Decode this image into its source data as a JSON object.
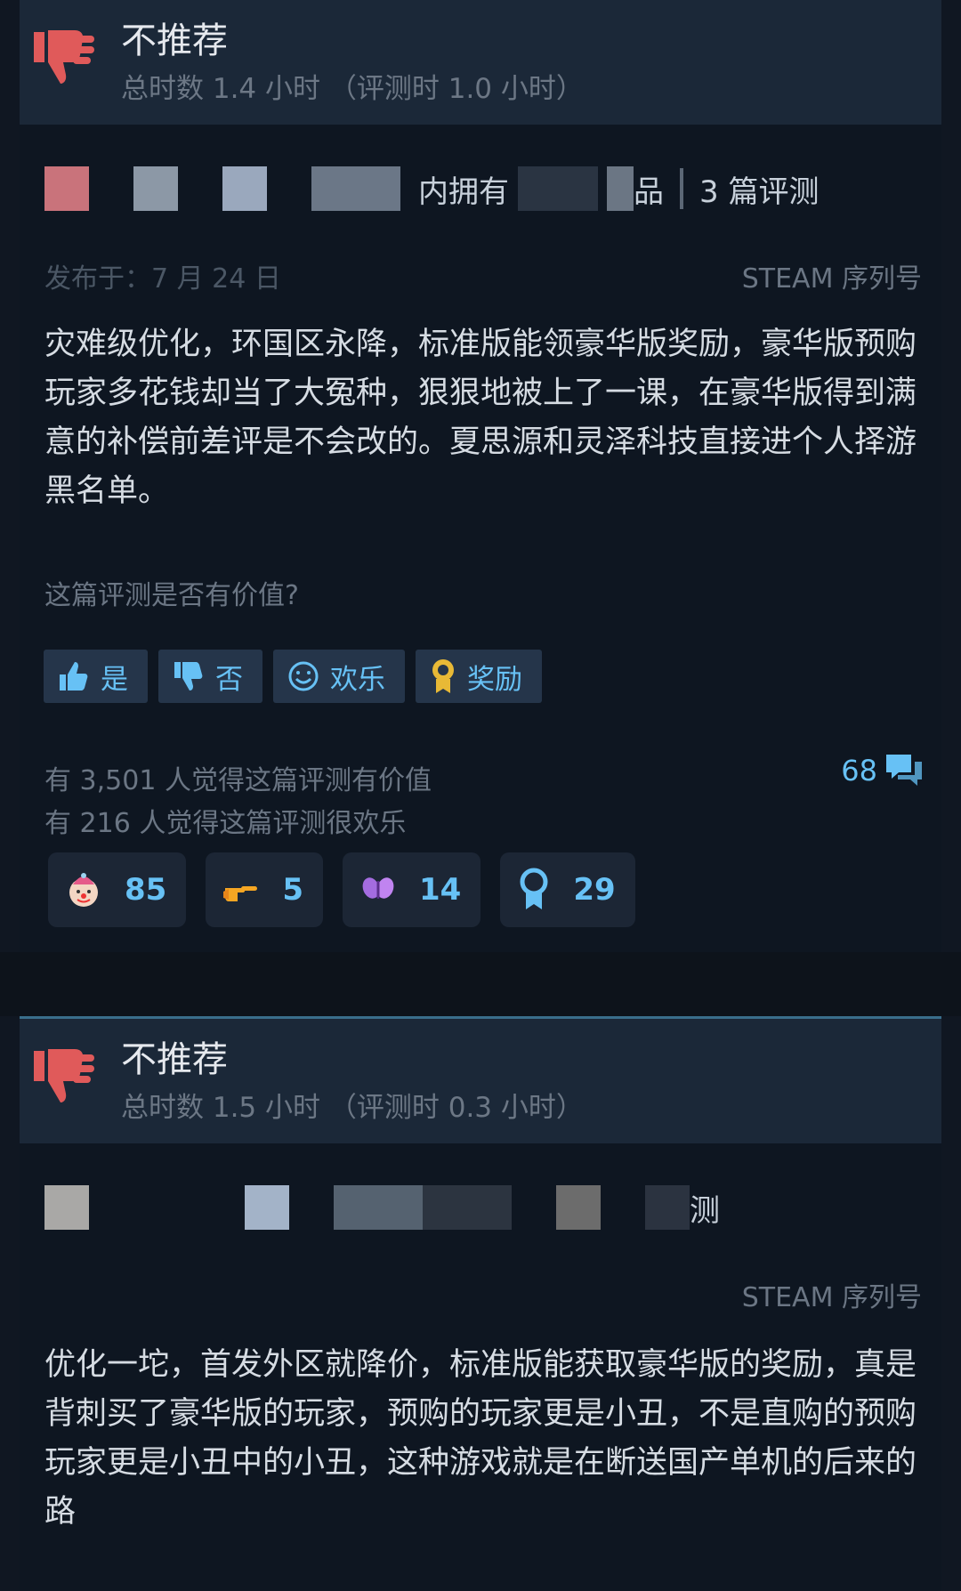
{
  "reviews": [
    {
      "verdict": "不推荐",
      "hours": "总时数 1.4 小时 （评测时 1.0 小时）",
      "author_text": "内拥有",
      "author_text_2": "品",
      "review_count": "3 篇评测",
      "posted": "发布于：7 月 24 日",
      "serial": "STEAM 序列号",
      "content": "灾难级优化，环国区永降，标准版能领豪华版奖励，豪华版预购玩家多花钱却当了大冤种，狠狠地被上了一课，在豪华版得到满意的补偿前差评是不会改的。夏思源和灵泽科技直接进个人择游黑名单。",
      "helpful_question": "这篇评测是否有价值?",
      "buttons": {
        "yes": "是",
        "no": "否",
        "funny": "欢乐",
        "award": "奖励"
      },
      "stat_helpful": "有 3,501 人觉得这篇评测有价值",
      "stat_funny": "有 216 人觉得这篇评测很欢乐",
      "comments": "68",
      "awards": [
        {
          "icon": "clown-face-icon",
          "count": "85"
        },
        {
          "icon": "pointing-hand-icon",
          "count": "5"
        },
        {
          "icon": "butterfly-icon",
          "count": "14"
        },
        {
          "icon": "ribbon-icon",
          "count": "29"
        }
      ]
    },
    {
      "verdict": "不推荐",
      "hours": "总时数 1.5 小时 （评测时 0.3 小时）",
      "author_text": "测",
      "serial": "STEAM 序列号",
      "content": "优化一坨，首发外区就降价，标准版能获取豪华版的奖励，真是背刺买了豪华版的玩家，预购的玩家更是小丑，不是直购的预购玩家更是小丑中的小丑，这种游戏就是在断送国产单机的后来的路"
    }
  ],
  "colors": {
    "accent": "#67c1f5",
    "thumb_down": "#e05a5a",
    "header_bg": "#1b2838",
    "body_bg": "#0e1621"
  }
}
